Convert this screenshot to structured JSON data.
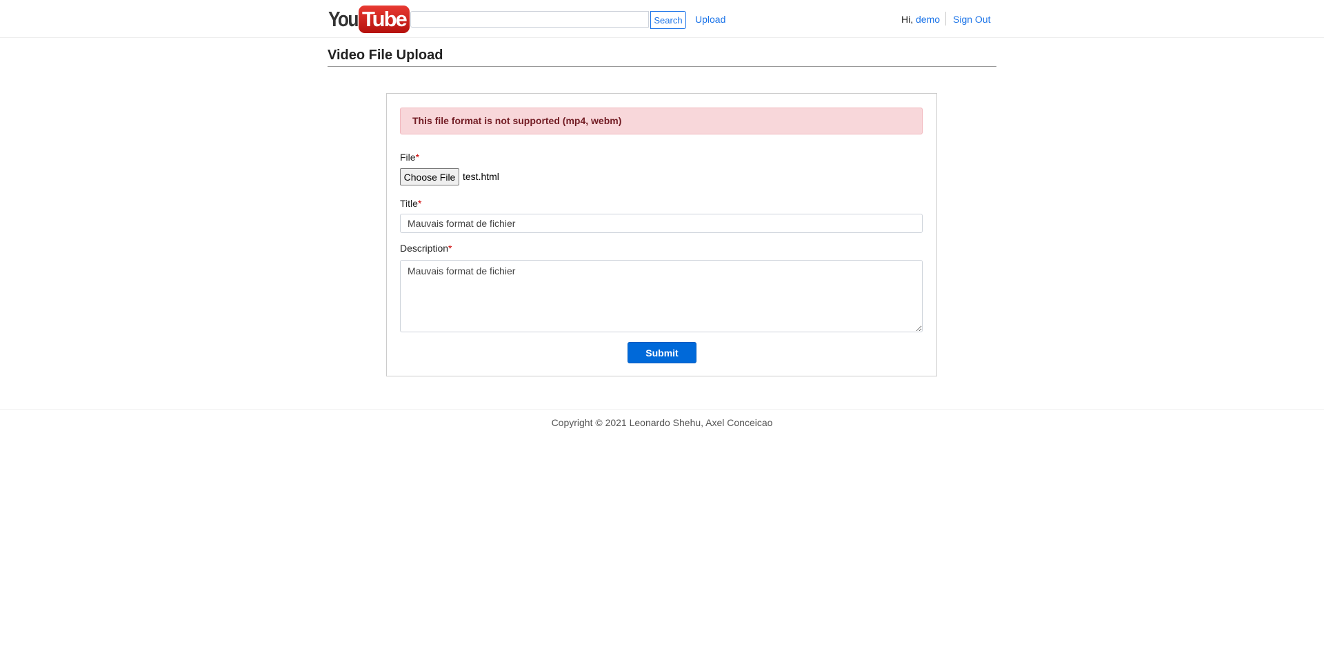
{
  "header": {
    "logo": {
      "part1": "You",
      "part2": "Tube"
    },
    "search": {
      "placeholder": "",
      "value": "",
      "button_label": "Search"
    },
    "upload_link": "Upload",
    "greeting": "Hi,",
    "username": "demo",
    "sign_out": "Sign Out"
  },
  "page": {
    "title": "Video File Upload"
  },
  "form": {
    "alert": "This file format is not supported (mp4, webm)",
    "file": {
      "label": "File",
      "required_mark": "*",
      "button_label": "Choose File",
      "file_name": "test.html"
    },
    "title": {
      "label": "Title",
      "required_mark": "*",
      "value": "Mauvais format de fichier"
    },
    "description": {
      "label": "Description",
      "required_mark": "*",
      "value": "Mauvais format de fichier"
    },
    "submit_label": "Submit"
  },
  "footer": {
    "copyright": "Copyright © 2021 Leonardo Shehu, Axel Conceicao"
  },
  "colors": {
    "accent": "#1a73e8",
    "submit": "#0069d9",
    "alert_bg": "#f8d7da",
    "alert_text": "#721c24"
  }
}
